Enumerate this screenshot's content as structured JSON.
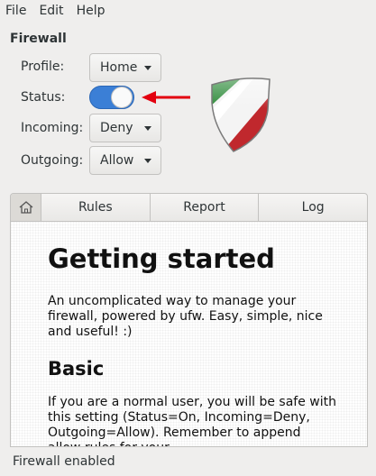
{
  "menu": {
    "file": "File",
    "edit": "Edit",
    "help": "Help"
  },
  "section_title": "Firewall",
  "profile": {
    "label": "Profile:",
    "value": "Home"
  },
  "status": {
    "label": "Status:",
    "on": true
  },
  "incoming": {
    "label": "Incoming:",
    "value": "Deny"
  },
  "outgoing": {
    "label": "Outgoing:",
    "value": "Allow"
  },
  "tabs": {
    "rules": "Rules",
    "report": "Report",
    "log": "Log"
  },
  "content": {
    "heading": "Getting started",
    "intro": "An uncomplicated way to manage your firewall, powered by ufw. Easy, simple, nice and useful! :)",
    "subheading": "Basic",
    "body": "If you are a normal user, you will be safe with this setting (Status=On, Incoming=Deny, Outgoing=Allow). Remember to append allow rules for your"
  },
  "statusbar": "Firewall enabled",
  "colors": {
    "switch_on": "#3b7fd6",
    "arrow": "#e3000f",
    "shield_green": "#2e8b3a",
    "shield_red": "#c0282d"
  }
}
